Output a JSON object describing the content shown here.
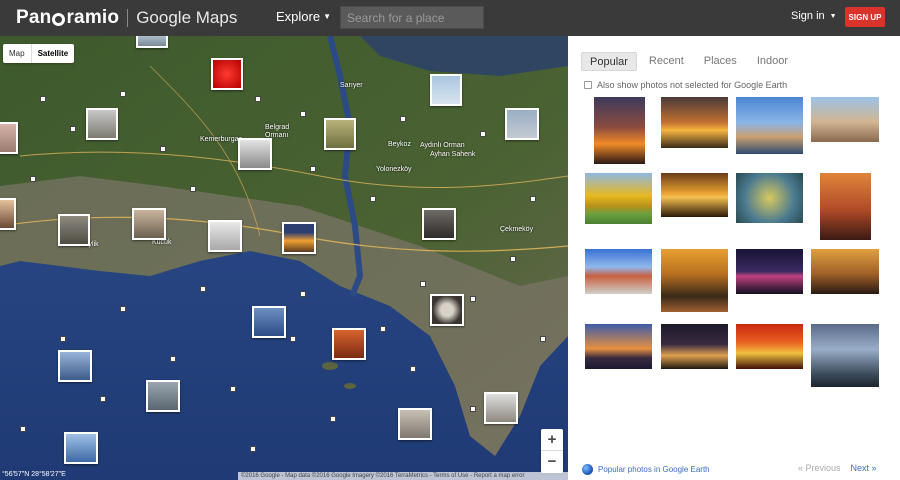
{
  "header": {
    "logo_pano_start": "Pan",
    "logo_pano_end": "ramio",
    "logo_google_maps": "Google Maps",
    "explore_label": "Explore",
    "search_placeholder": "Search for a place",
    "signin_label": "Sign in",
    "signup_label": "SIGN UP"
  },
  "map": {
    "type_map": "Map",
    "type_satellite": "Satellite",
    "zoom_in": "+",
    "zoom_out": "−",
    "coords": "°56'57\"N 28°58'27\"E",
    "attribution": "©2016 Google - Map data ©2016 Google Imagery ©2016 TerraMetrics - Terms of Use - Report a map error",
    "labels": [
      {
        "text": "Belgrad"
      },
      {
        "text": "Ormanı"
      },
      {
        "text": "Aydınlı Orman"
      },
      {
        "text": "Ayhan Sahenk"
      },
      {
        "text": "Kemerburgaz"
      },
      {
        "text": "Yolonezköy"
      },
      {
        "text": "Beykoz"
      },
      {
        "text": "Çekmeköy"
      },
      {
        "text": "Kücük"
      },
      {
        "text": "Beylik"
      },
      {
        "text": "Sarıyer"
      }
    ]
  },
  "panel": {
    "tabs": [
      {
        "label": "Popular",
        "active": true
      },
      {
        "label": "Recent",
        "active": false
      },
      {
        "label": "Places",
        "active": false
      },
      {
        "label": "Indoor",
        "active": false
      }
    ],
    "also_show_label": "Also show photos not selected for Google Earth",
    "ge_link_label": "Popular photos in Google Earth",
    "prev_label": "« Previous",
    "next_label": "Next »"
  },
  "colors": {
    "topbar": "#3a3a3a",
    "signup": "#d9332b",
    "link": "#3a6fc4"
  }
}
